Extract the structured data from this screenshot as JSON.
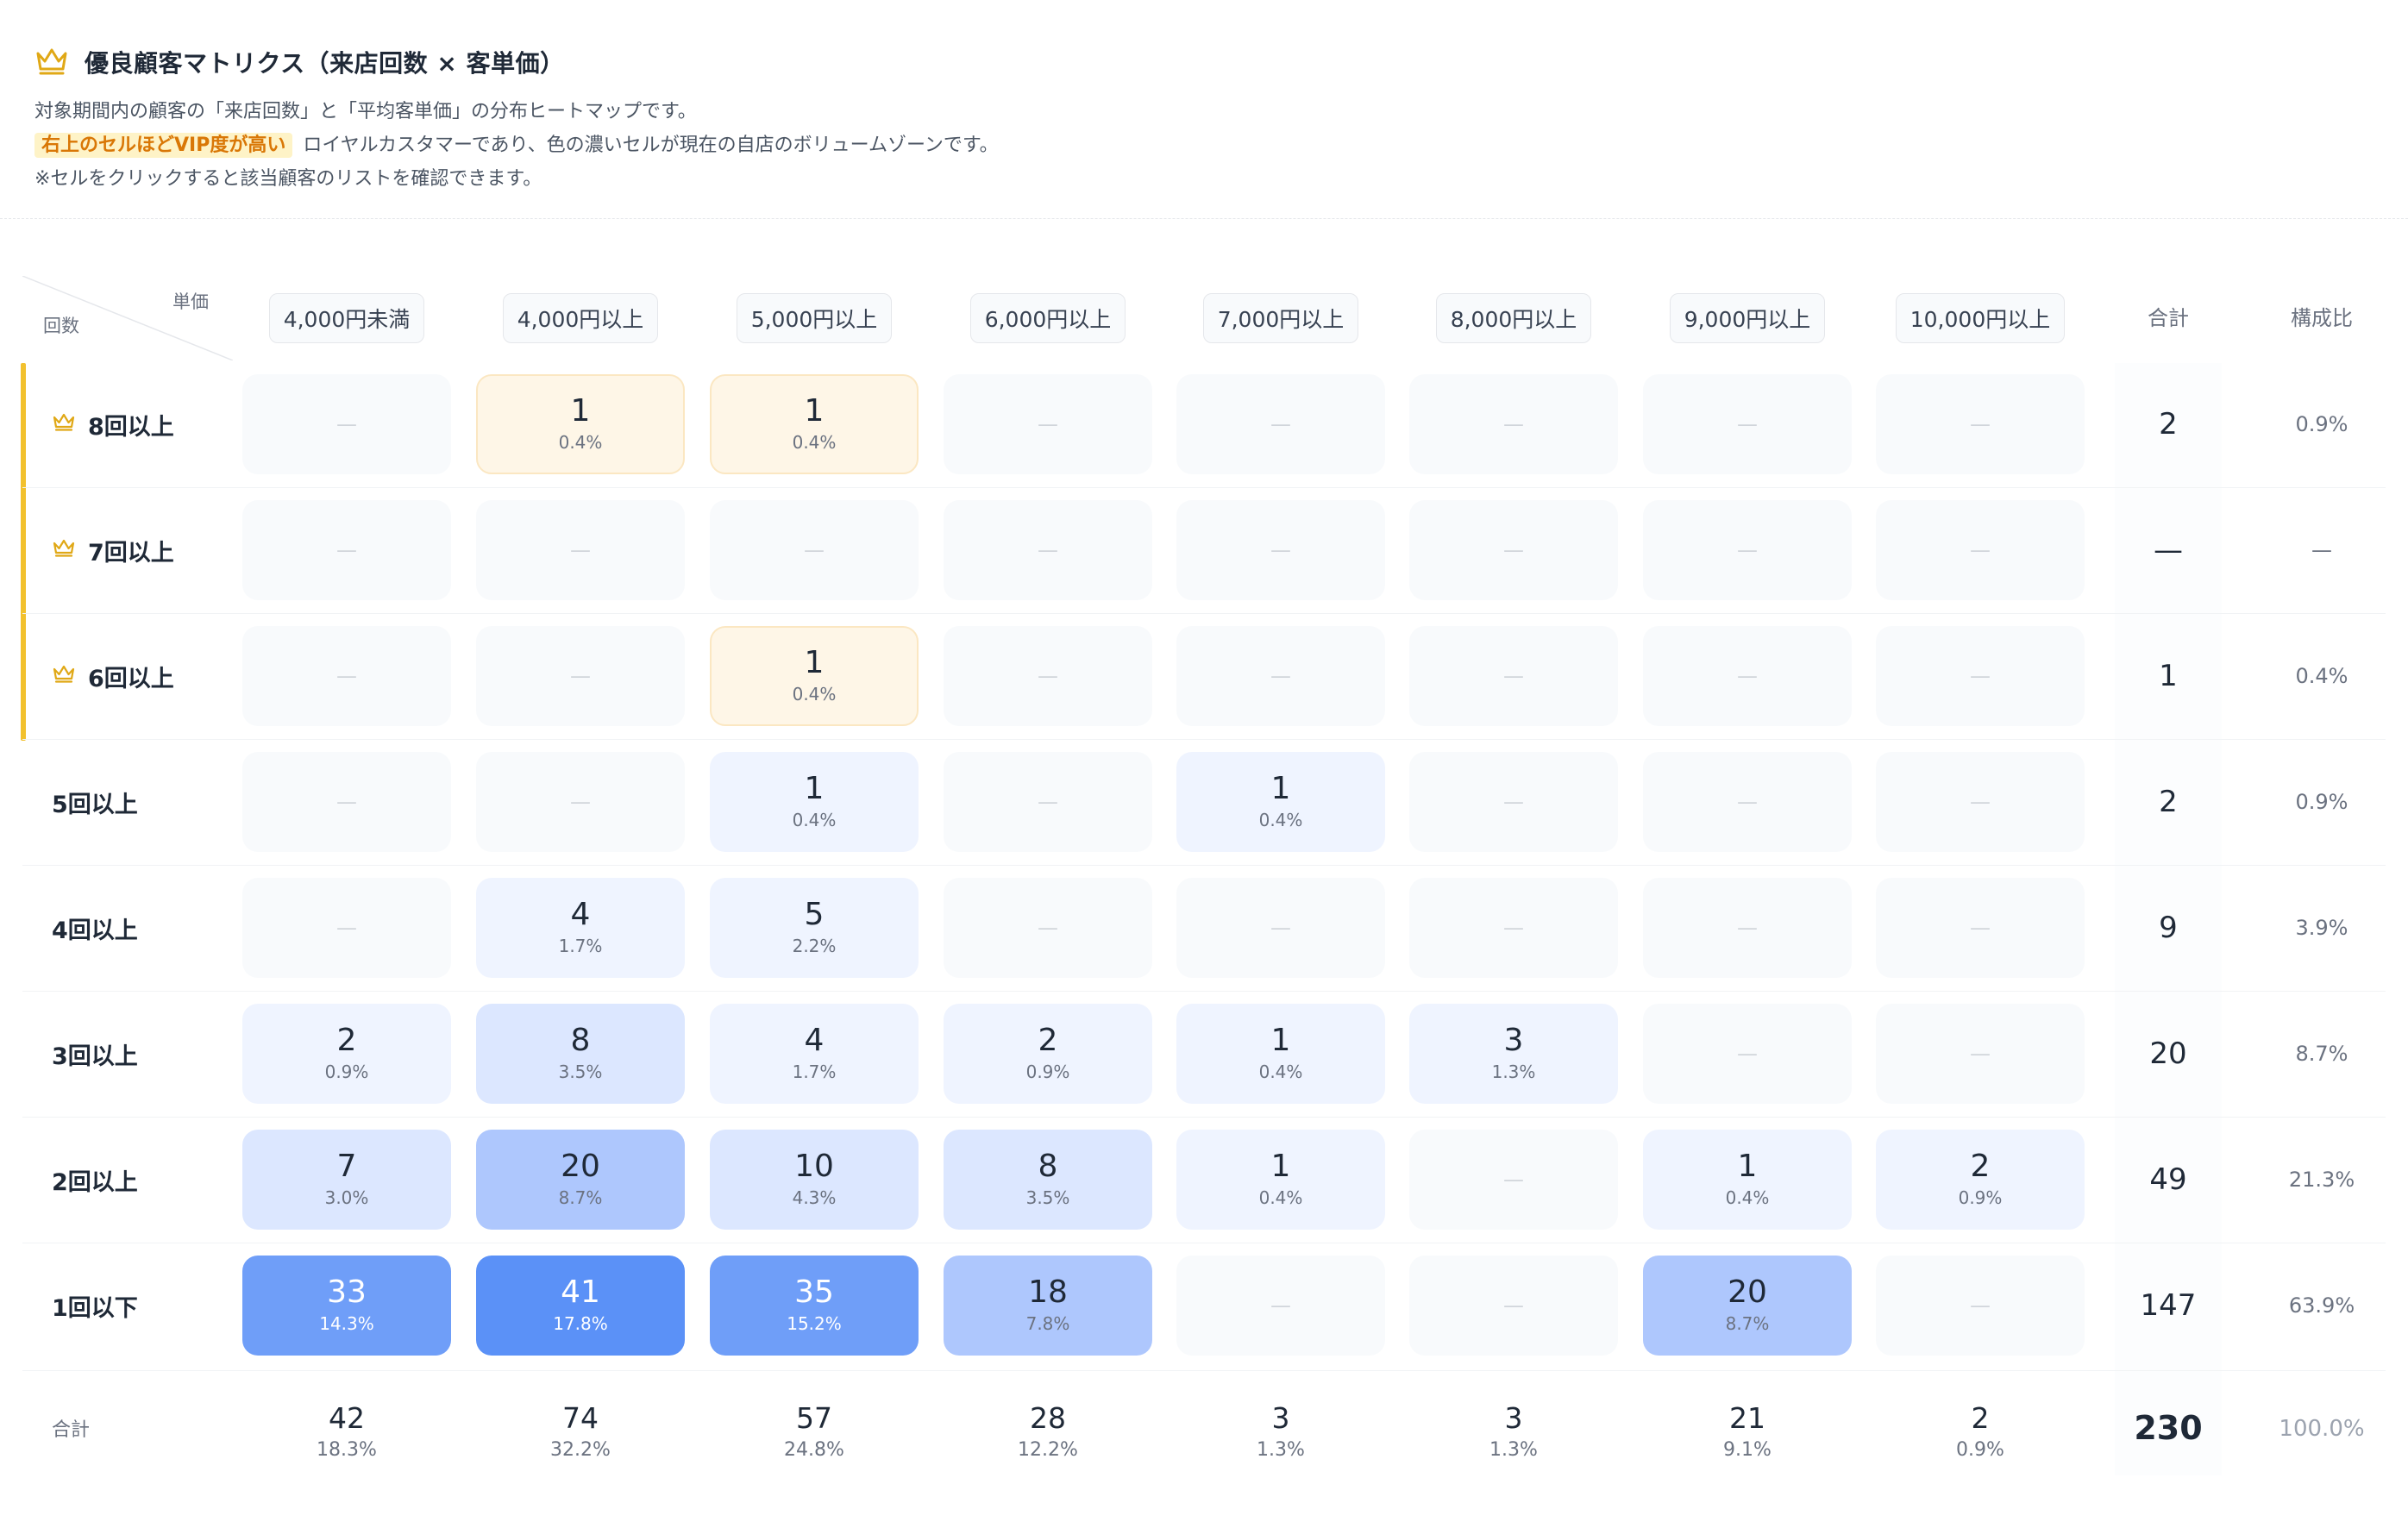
{
  "header": {
    "title": "優良顧客マトリクス（来店回数 × 客単価）",
    "desc1": "対象期間内の顧客の「来店回数」と「平均客単価」の分布ヒートマップです。",
    "highlight": "右上のセルほどVIP度が高い",
    "desc2_rest": "ロイヤルカスタマーであり、色の濃いセルが現在の自店のボリュームゾーンです。",
    "desc3": "※セルをクリックすると該当顧客のリストを確認できます。"
  },
  "corner": {
    "price": "単価",
    "visits": "回数"
  },
  "columns": [
    "4,000円未満",
    "4,000円以上",
    "5,000円以上",
    "6,000円以上",
    "7,000円以上",
    "8,000円以上",
    "9,000円以上",
    "10,000円以上"
  ],
  "sum_header": "合計",
  "ratio_header": "構成比",
  "empty_mark": "—",
  "rows": [
    {
      "label": "8回以上",
      "vip": true,
      "total": "2",
      "ratio": "0.9%",
      "cells": [
        null,
        {
          "n": "1",
          "p": "0.4%"
        },
        {
          "n": "1",
          "p": "0.4%"
        },
        null,
        null,
        null,
        null,
        null
      ]
    },
    {
      "label": "7回以上",
      "vip": true,
      "total": "—",
      "ratio": "—",
      "cells": [
        null,
        null,
        null,
        null,
        null,
        null,
        null,
        null
      ]
    },
    {
      "label": "6回以上",
      "vip": true,
      "total": "1",
      "ratio": "0.4%",
      "cells": [
        null,
        null,
        {
          "n": "1",
          "p": "0.4%"
        },
        null,
        null,
        null,
        null,
        null
      ]
    },
    {
      "label": "5回以上",
      "vip": false,
      "total": "2",
      "ratio": "0.9%",
      "cells": [
        null,
        null,
        {
          "n": "1",
          "p": "0.4%"
        },
        null,
        {
          "n": "1",
          "p": "0.4%"
        },
        null,
        null,
        null
      ]
    },
    {
      "label": "4回以上",
      "vip": false,
      "total": "9",
      "ratio": "3.9%",
      "cells": [
        null,
        {
          "n": "4",
          "p": "1.7%"
        },
        {
          "n": "5",
          "p": "2.2%"
        },
        null,
        null,
        null,
        null,
        null
      ]
    },
    {
      "label": "3回以上",
      "vip": false,
      "total": "20",
      "ratio": "8.7%",
      "cells": [
        {
          "n": "2",
          "p": "0.9%"
        },
        {
          "n": "8",
          "p": "3.5%"
        },
        {
          "n": "4",
          "p": "1.7%"
        },
        {
          "n": "2",
          "p": "0.9%"
        },
        {
          "n": "1",
          "p": "0.4%"
        },
        {
          "n": "3",
          "p": "1.3%"
        },
        null,
        null
      ]
    },
    {
      "label": "2回以上",
      "vip": false,
      "total": "49",
      "ratio": "21.3%",
      "cells": [
        {
          "n": "7",
          "p": "3.0%"
        },
        {
          "n": "20",
          "p": "8.7%"
        },
        {
          "n": "10",
          "p": "4.3%"
        },
        {
          "n": "8",
          "p": "3.5%"
        },
        {
          "n": "1",
          "p": "0.4%"
        },
        null,
        {
          "n": "1",
          "p": "0.4%"
        },
        {
          "n": "2",
          "p": "0.9%"
        }
      ]
    },
    {
      "label": "1回以下",
      "vip": false,
      "total": "147",
      "ratio": "63.9%",
      "cells": [
        {
          "n": "33",
          "p": "14.3%"
        },
        {
          "n": "41",
          "p": "17.8%"
        },
        {
          "n": "35",
          "p": "15.2%"
        },
        {
          "n": "18",
          "p": "7.8%"
        },
        null,
        null,
        {
          "n": "20",
          "p": "8.7%"
        },
        null
      ]
    }
  ],
  "footer": {
    "label": "合計",
    "totals": [
      {
        "n": "42",
        "p": "18.3%"
      },
      {
        "n": "74",
        "p": "32.2%"
      },
      {
        "n": "57",
        "p": "24.8%"
      },
      {
        "n": "28",
        "p": "12.2%"
      },
      {
        "n": "3",
        "p": "1.3%"
      },
      {
        "n": "3",
        "p": "1.3%"
      },
      {
        "n": "21",
        "p": "9.1%"
      },
      {
        "n": "2",
        "p": "0.9%"
      }
    ],
    "grand_total": "230",
    "grand_ratio": "100.0%"
  },
  "colors": {
    "vip_accent": "#f2c12e",
    "vip_cell": "#fef6e7",
    "heat_light": "#eff4ff",
    "heat_dark": "#5b91f7"
  },
  "icons": {
    "title_icon": "crown-icon",
    "vip_row_icon": "crown-icon"
  }
}
